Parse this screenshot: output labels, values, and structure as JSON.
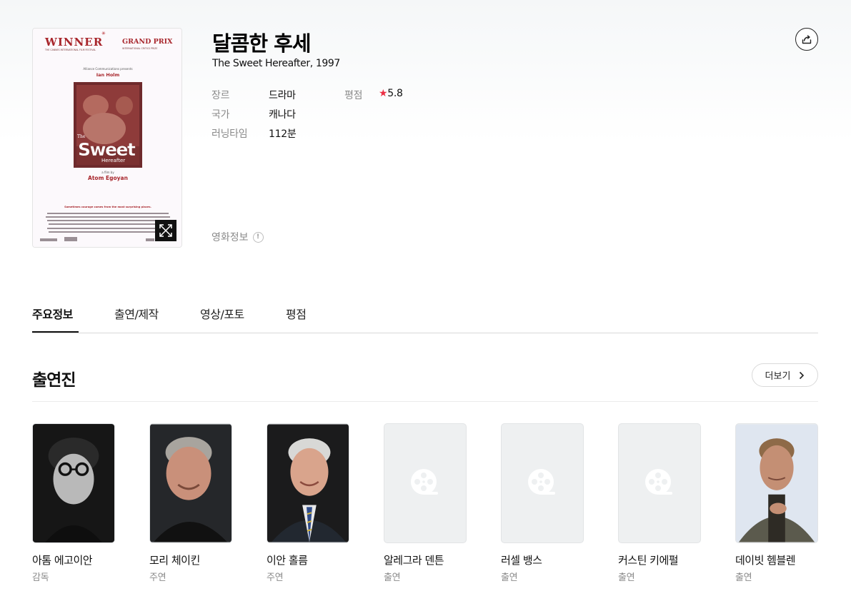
{
  "movie": {
    "title": "달콤한 후세",
    "subtitle": "The Sweet Hereafter, 1997",
    "genre_label": "장르",
    "genre": "드라마",
    "country_label": "국가",
    "country": "캐나다",
    "runtime_label": "러닝타임",
    "runtime": "112분",
    "rating_label": "평점",
    "rating": "5.8",
    "info_link": "영화정보"
  },
  "poster": {
    "logo": "✳",
    "winner": "WINNER",
    "grand_prix": "GRAND PRIX",
    "festival_left": "THE CANNES INTERNATIONAL FILM FESTIVAL",
    "festival_right": "INTERNATIONAL CRITICS PRIZE",
    "presents": "Alliance Communications presents",
    "actor": "Ian Holm",
    "title_the": "The",
    "title_sweet": "Sweet",
    "title_hereafter": "Hereafter",
    "film_by": "a film by",
    "director": "Atom Egoyan",
    "tagline": "Sometimes courage comes from the most surprising places."
  },
  "tabs": [
    {
      "label": "주요정보",
      "active": true
    },
    {
      "label": "출연/제작",
      "active": false
    },
    {
      "label": "영상/포토",
      "active": false
    },
    {
      "label": "평점",
      "active": false
    }
  ],
  "cast_section": {
    "title": "출연진",
    "more_label": "더보기"
  },
  "cast": [
    {
      "name": "아톰 에고이안",
      "role": "감독",
      "photo": "person"
    },
    {
      "name": "모리 체이킨",
      "role": "주연",
      "photo": "person"
    },
    {
      "name": "이안 홀름",
      "role": "주연",
      "photo": "person"
    },
    {
      "name": "알레그라 덴튼",
      "role": "출연",
      "photo": "film-reel-icon"
    },
    {
      "name": "러셀 뱅스",
      "role": "출연",
      "photo": "film-reel-icon"
    },
    {
      "name": "커스틴 키에펄",
      "role": "출연",
      "photo": "film-reel-icon"
    },
    {
      "name": "데이빗 헴블렌",
      "role": "출연",
      "photo": "person"
    }
  ],
  "colors": {
    "accent_star": "#ec2f45",
    "poster_red": "#b5282c"
  }
}
